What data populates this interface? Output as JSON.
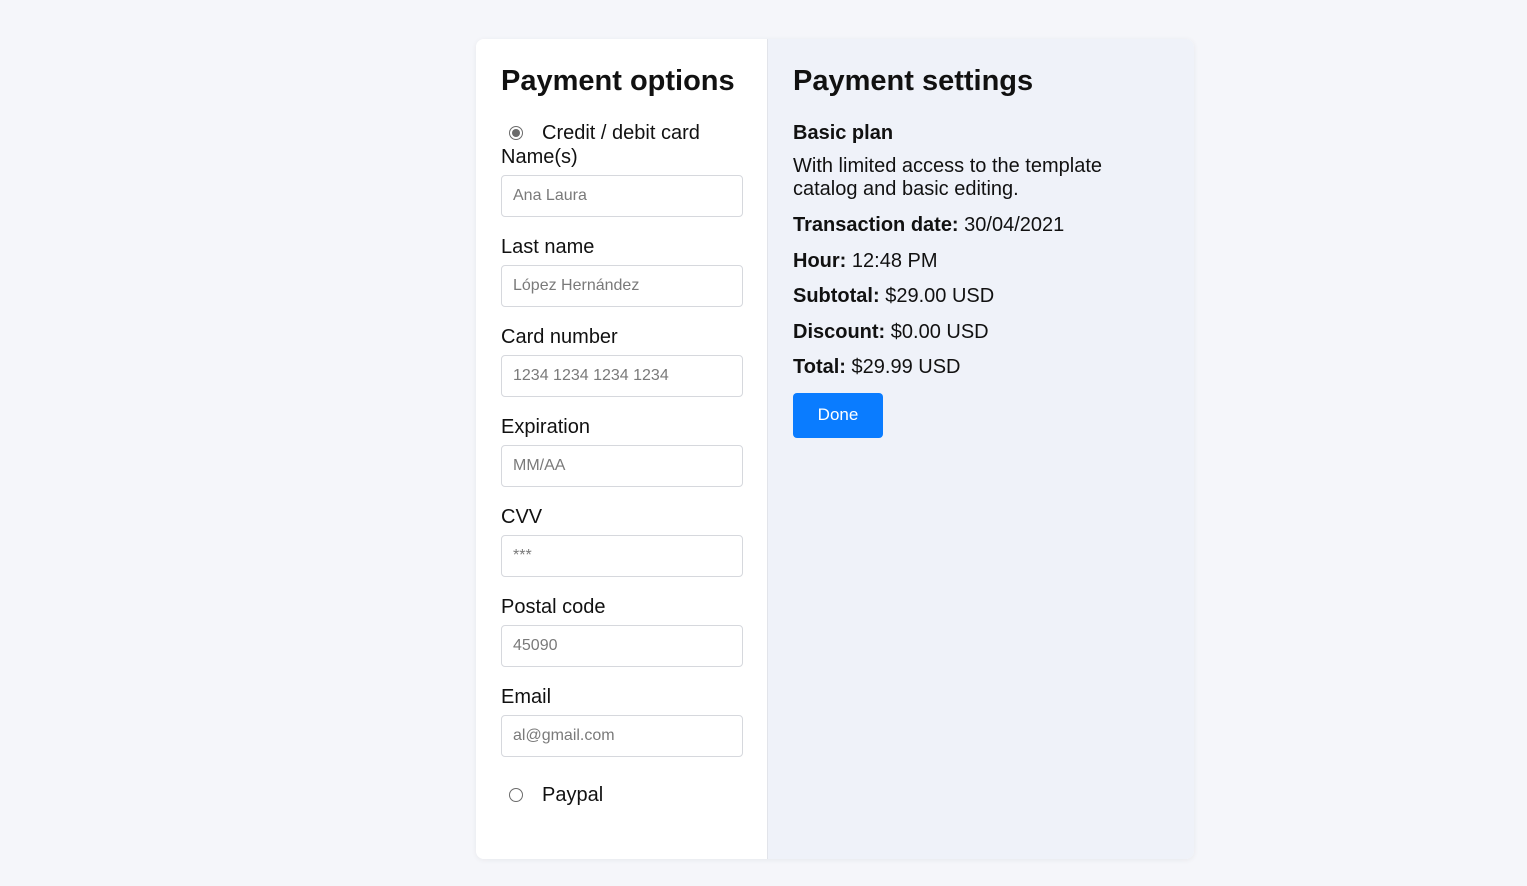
{
  "options": {
    "title": "Payment options",
    "card_option": {
      "label": "Credit / debit card",
      "selected": true
    },
    "fields": {
      "names": {
        "label": "Name(s)",
        "placeholder": "Ana Laura"
      },
      "last_name": {
        "label": "Last name",
        "placeholder": "López Hernández"
      },
      "card_number": {
        "label": "Card number",
        "placeholder": "1234 1234 1234 1234"
      },
      "expiration": {
        "label": "Expiration",
        "placeholder": "MM/AA"
      },
      "cvv": {
        "label": "CVV",
        "placeholder": "***"
      },
      "postal_code": {
        "label": "Postal code",
        "placeholder": "45090"
      },
      "email": {
        "label": "Email",
        "placeholder": "al@gmail.com"
      }
    },
    "paypal_option": {
      "label": "Paypal",
      "selected": false
    }
  },
  "settings": {
    "title": "Payment settings",
    "plan_name": "Basic plan",
    "plan_description": "With limited access to the template catalog and basic editing.",
    "transaction_date": {
      "label": "Transaction date:",
      "value": "30/04/2021"
    },
    "hour": {
      "label": "Hour:",
      "value": "12:48 PM"
    },
    "subtotal": {
      "label": "Subtotal:",
      "value": "$29.00 USD"
    },
    "discount": {
      "label": "Discount:",
      "value": "$0.00 USD"
    },
    "total": {
      "label": "Total:",
      "value": "$29.99 USD"
    },
    "done_label": "Done"
  },
  "colors": {
    "page_background": "#f5f6fa",
    "settings_background": "#eff2f9",
    "accent": "#0a7cff"
  }
}
